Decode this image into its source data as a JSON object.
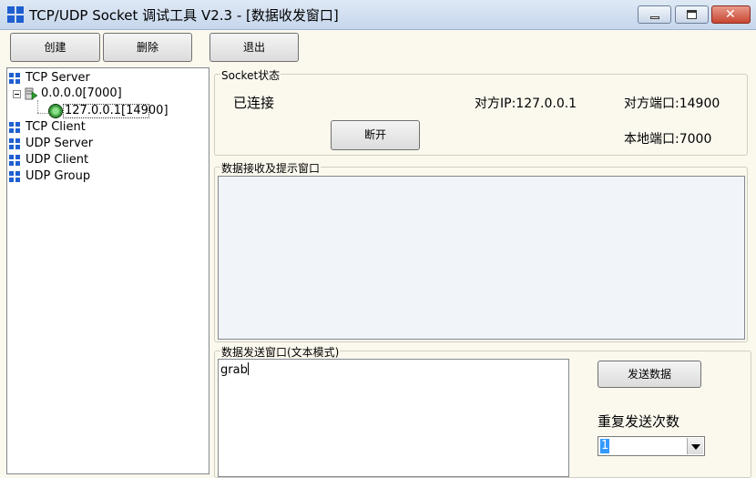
{
  "window": {
    "title": "TCP/UDP Socket 调试工具 V2.3 - [数据收发窗口]",
    "controls": {
      "minimize": "",
      "maximize": "",
      "close": "✕"
    }
  },
  "toolbar": {
    "create_label": "创建",
    "delete_label": "删除",
    "exit_label": "退出"
  },
  "tree": {
    "tcp_server": "TCP Server",
    "server_node": "0.0.0.0[7000]",
    "client_node": "127.0.0.1[14900]",
    "tcp_client": "TCP Client",
    "udp_server": "UDP Server",
    "udp_client": "UDP Client",
    "udp_group": "UDP Group"
  },
  "socket_status": {
    "group_title": "Socket状态",
    "state": "已连接",
    "remote_ip": "对方IP:127.0.0.1",
    "remote_port": "对方端口:14900",
    "local_port": "本地端口:7000",
    "disconnect_label": "断开"
  },
  "receive": {
    "group_title": "数据接收及提示窗口",
    "content": ""
  },
  "send": {
    "group_title": "数据发送窗口(文本模式)",
    "content": "grab",
    "send_label": "发送数据",
    "repeat_label": "重复发送次数",
    "repeat_value": "1"
  },
  "colors": {
    "accent": "#1f5fd0",
    "background": "#fbf8ee",
    "selection": "#3399ff"
  }
}
